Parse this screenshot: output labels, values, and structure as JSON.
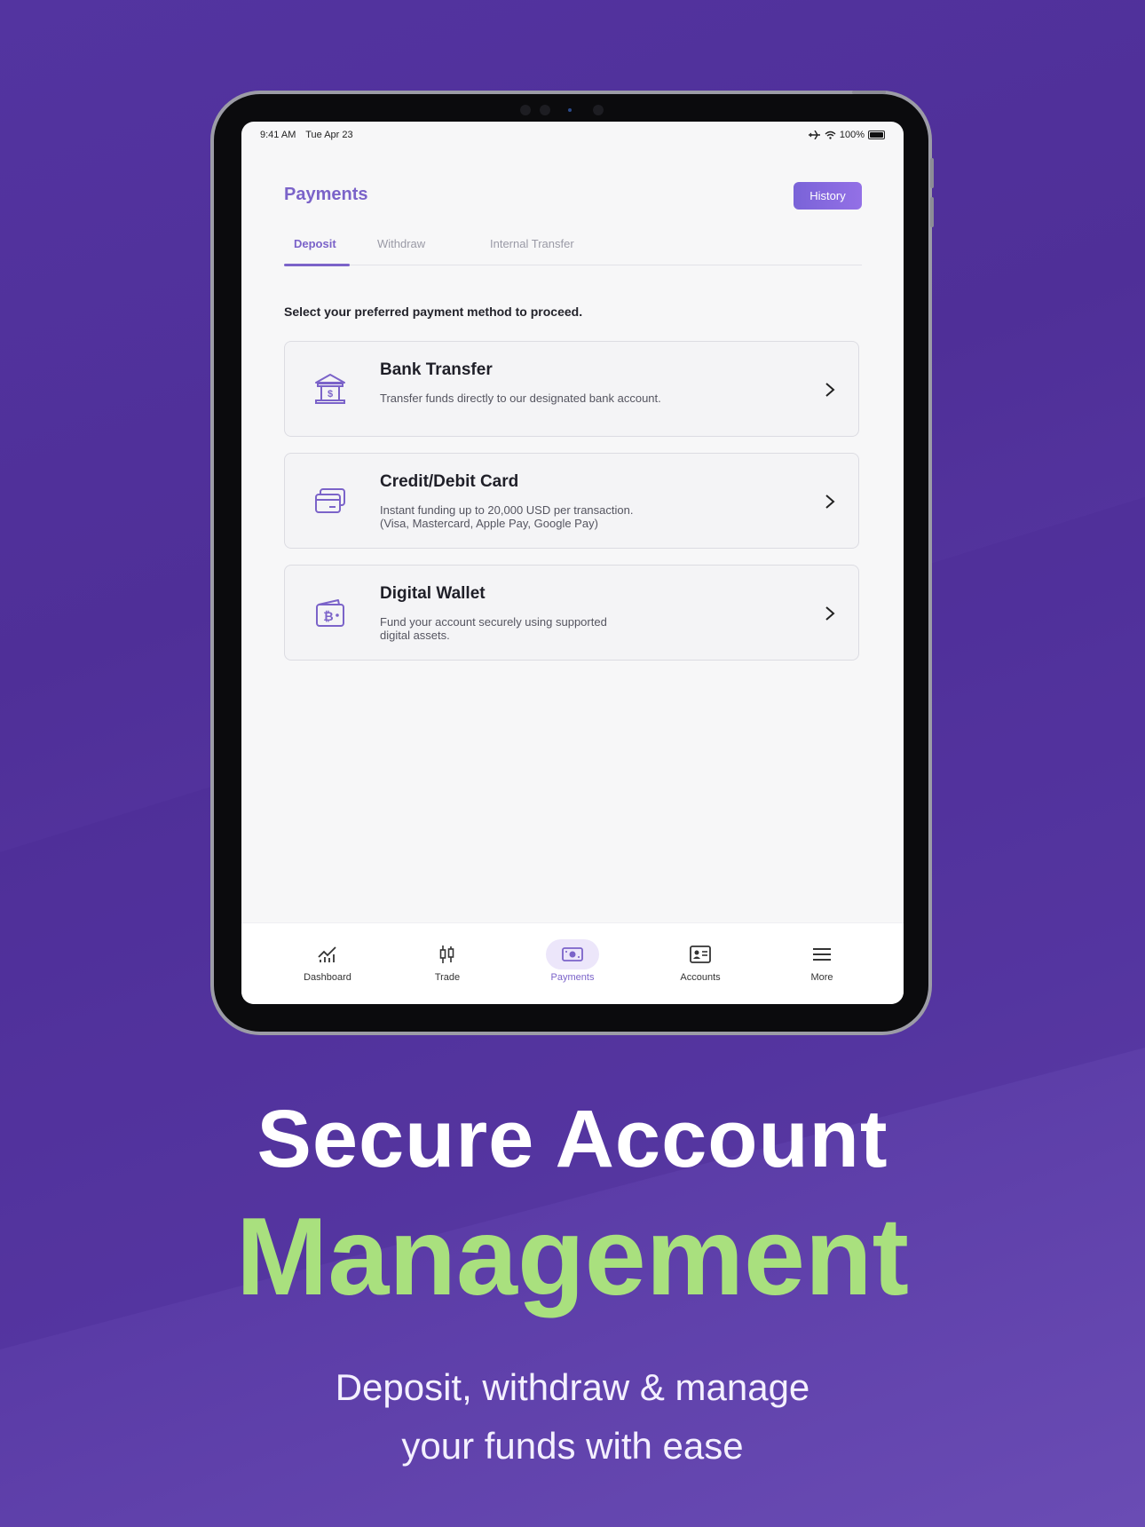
{
  "status_bar": {
    "time": "9:41 AM",
    "date": "Tue Apr 23",
    "battery": "100%"
  },
  "header": {
    "title": "Payments",
    "history_label": "History"
  },
  "tabs": [
    {
      "label": "Deposit",
      "active": true
    },
    {
      "label": "Withdraw",
      "active": false
    },
    {
      "label": "Internal Transfer",
      "active": false
    }
  ],
  "instruction": "Select your preferred payment method to proceed.",
  "methods": [
    {
      "title": "Bank Transfer",
      "description": "Transfer funds directly to our designated bank account.",
      "icon": "bank-icon"
    },
    {
      "title": "Credit/Debit Card",
      "description": "Instant funding up to 20,000 USD per transaction. (Visa, Mastercard, Apple Pay, Google Pay)",
      "icon": "card-icon"
    },
    {
      "title": "Digital Wallet",
      "description": "Fund your account securely using supported digital assets.",
      "icon": "bitcoin-wallet-icon"
    }
  ],
  "bottom_nav": [
    {
      "label": "Dashboard",
      "icon": "chart-icon",
      "active": false
    },
    {
      "label": "Trade",
      "icon": "candlestick-icon",
      "active": false
    },
    {
      "label": "Payments",
      "icon": "cash-icon",
      "active": true
    },
    {
      "label": "Accounts",
      "icon": "id-card-icon",
      "active": false
    },
    {
      "label": "More",
      "icon": "menu-icon",
      "active": false
    }
  ],
  "hero": {
    "line1": "Secure Account",
    "line2": "Management",
    "subtitle_line1": "Deposit, withdraw & manage",
    "subtitle_line2": "your funds with ease"
  },
  "colors": {
    "accent": "#7b63c9",
    "highlight": "#a9e07e",
    "background": "#5334a0"
  }
}
